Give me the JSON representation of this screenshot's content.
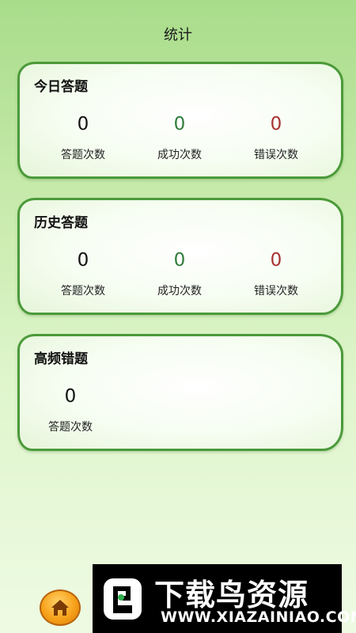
{
  "header": {
    "title": "统计"
  },
  "today": {
    "title": "今日答题",
    "answered": {
      "value": "0",
      "label": "答题次数"
    },
    "success": {
      "value": "0",
      "label": "成功次数"
    },
    "error": {
      "value": "0",
      "label": "错误次数"
    }
  },
  "history": {
    "title": "历史答题",
    "answered": {
      "value": "0",
      "label": "答题次数"
    },
    "success": {
      "value": "0",
      "label": "成功次数"
    },
    "error": {
      "value": "0",
      "label": "错误次数"
    }
  },
  "frequent_errors": {
    "title": "高频错题",
    "answered": {
      "value": "0",
      "label": "答题次数"
    }
  },
  "nav": {
    "home_icon": "home-icon"
  },
  "watermark": {
    "brand": "下载鸟资源",
    "url": "WWW.XIAZAINIAO.COM"
  },
  "colors": {
    "success": "#2f7d3a",
    "error": "#a83232",
    "border": "#4b9a3a"
  }
}
